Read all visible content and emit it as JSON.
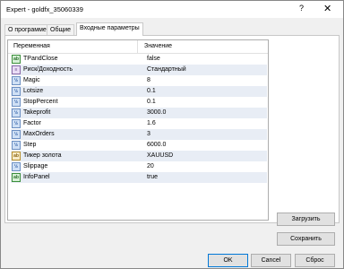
{
  "window": {
    "title": "Expert - goldfx_35060339",
    "help_glyph": "?",
    "close_glyph": "✕"
  },
  "tabs": [
    {
      "label": "О программе"
    },
    {
      "label": "Общие"
    },
    {
      "label": "Входные параметры"
    }
  ],
  "table": {
    "headers": {
      "name": "Переменная",
      "value": "Значение"
    },
    "rows": [
      {
        "icon": "bool-icon",
        "name": "TPandClose",
        "value": "false"
      },
      {
        "icon": "enum-icon",
        "name": "Риск/Доходность",
        "value": "Стандартный"
      },
      {
        "icon": "number-icon",
        "name": "Magic",
        "value": "8"
      },
      {
        "icon": "number-icon",
        "name": "Lotsize",
        "value": "0.1"
      },
      {
        "icon": "number-icon",
        "name": "StopPercent",
        "value": "0.1"
      },
      {
        "icon": "number-icon",
        "name": "Takeprofit",
        "value": "3000.0"
      },
      {
        "icon": "number-icon",
        "name": "Factor",
        "value": "1.6"
      },
      {
        "icon": "number-icon",
        "name": "MaxOrders",
        "value": "3"
      },
      {
        "icon": "number-icon",
        "name": "Step",
        "value": "6000.0"
      },
      {
        "icon": "string-icon",
        "name": "Тикер золота",
        "value": "XAUUSD"
      },
      {
        "icon": "number-icon",
        "name": "Slippage",
        "value": "20"
      },
      {
        "icon": "bool-icon",
        "name": "InfoPanel",
        "value": "true"
      }
    ]
  },
  "side_buttons": {
    "load": "Загрузить",
    "save": "Сохранить"
  },
  "bottom_buttons": {
    "ok": "OK",
    "cancel": "Cancel",
    "reset": "Сброс"
  }
}
